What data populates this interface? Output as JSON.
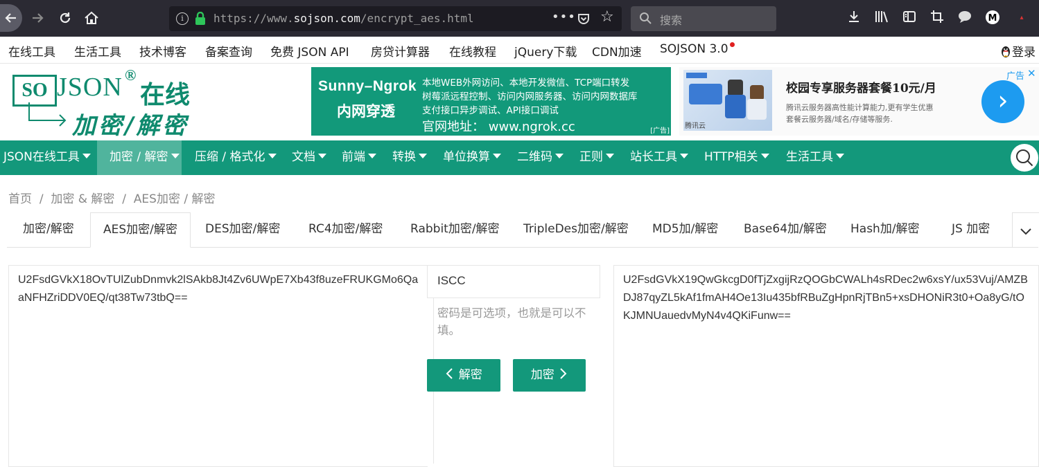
{
  "browser": {
    "url_prefix": "https://www.",
    "url_domain": "sojson.com",
    "url_path": "/encrypt_aes.html",
    "more_label": "•••",
    "search_placeholder": "搜索"
  },
  "top_links": [
    "在线工具",
    "生活工具",
    "技术博客",
    "备案查询",
    "免费 JSON API",
    "房贷计算器",
    "在线教程",
    "jQuery下载",
    "CDN加速",
    "SOJSON 3.0"
  ],
  "login_label": "登录",
  "logo": {
    "so": "SO",
    "json": "JSON",
    "reg": "®",
    "zx": "在线",
    "sub": "加密/解密"
  },
  "ad1": {
    "title": "Sunny–Ngrok",
    "subtitle": "内网穿透",
    "lines": [
      "本地WEB外网访问、本地开发微信、TCP端口转发",
      "树莓派远程控制、访问内网服务器、访问内网数据库",
      "支付接口异步调试、API接口调试"
    ],
    "website": "官网地址：  www.ngrok.cc",
    "tag": "[广告]"
  },
  "ad2": {
    "title": "校园专享服务器套餐10元/月",
    "desc_line1": "腾讯云服务器高性能计算能力,更有学生优惠",
    "desc_line2": "套餐云服务器/域名/存储等服务.",
    "ad_label": "广告",
    "close": "✕",
    "go": "›",
    "brand": "腾讯云"
  },
  "mainnav": [
    "JSON在线工具",
    "加密 / 解密",
    "压缩 / 格式化",
    "文档",
    "前端",
    "转换",
    "单位换算",
    "二维码",
    "正则",
    "站长工具",
    "HTTP相关",
    "生活工具"
  ],
  "breadcrumb": {
    "home": "首页",
    "sep": "/",
    "c1": "加密 & 解密",
    "c2": "AES加密 / 解密"
  },
  "tabs": [
    "加密/解密",
    "AES加密/解密",
    "DES加密/解密",
    "RC4加密/解密",
    "Rabbit加密/解密",
    "TripleDes加密/解密",
    "MD5加/解密",
    "Base64加/解密",
    "Hash加/解密",
    "JS 加密"
  ],
  "work": {
    "left_text": "U2FsdGVkX18OvTUlZubDnmvk2lSAkb8Jt4Zv6UWpE7Xb43f8uzeFRUKGMo6QaaNFHZriDDV0EQ/qt38Tw73tbQ==",
    "key_value": "ISCC",
    "hint": "密码是可选项，也就是可以不填。",
    "decrypt_label": "解密",
    "encrypt_label": "加密",
    "right_text": "U2FsdGVkX19QwGkcgD0fTjZxgijRzQOGbCWALh4sRDec2w6xsY/ux53Vuj/AMZBDJ87qyZL5kAf1fmAH4Oe13Iu435bfRBuZgHpnRjTBn5+xsDHONiR3t0+Oa8yG/tOKJMNUauedvMyN4v4QKiFunw=="
  },
  "colors": {
    "brand_green": "#13987b",
    "nav_active": "#50b49d",
    "browser_bg": "#2b2a33"
  }
}
